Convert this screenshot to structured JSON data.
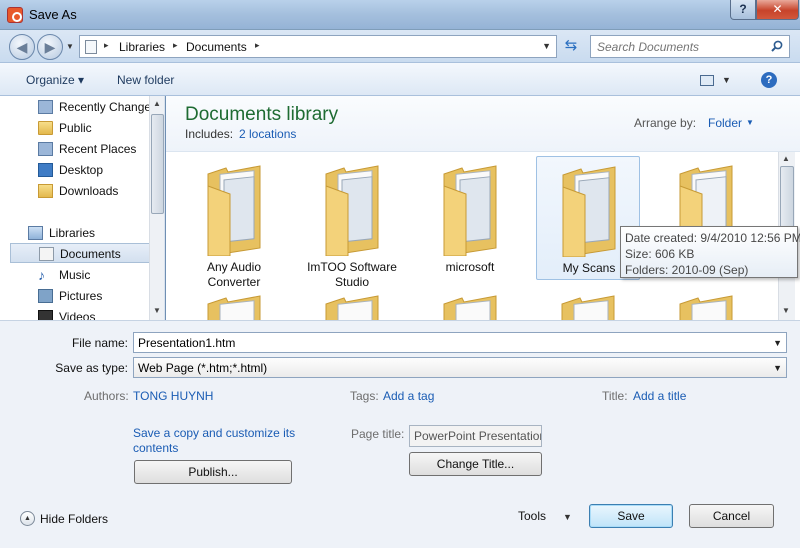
{
  "window": {
    "title": "Save As",
    "help_glyph": "?",
    "close_glyph": "✕"
  },
  "address": {
    "crumbs": [
      "Libraries",
      "Documents"
    ],
    "separator": "▸"
  },
  "search": {
    "placeholder": "Search Documents"
  },
  "toolbar": {
    "organize": "Organize ▾",
    "new_folder": "New folder",
    "help": "?"
  },
  "nav": {
    "items": [
      {
        "label": "Recently Changed",
        "icon": "recent-icon"
      },
      {
        "label": "Public",
        "icon": "folder-icon"
      },
      {
        "label": "Recent Places",
        "icon": "recent-places-icon"
      },
      {
        "label": "Desktop",
        "icon": "desktop-icon"
      },
      {
        "label": "Downloads",
        "icon": "downloads-icon"
      },
      {
        "label": "Libraries",
        "icon": "library-icon"
      },
      {
        "label": "Documents",
        "icon": "documents-icon"
      },
      {
        "label": "Music",
        "icon": "music-icon"
      },
      {
        "label": "Pictures",
        "icon": "pictures-icon"
      },
      {
        "label": "Videos",
        "icon": "videos-icon"
      }
    ],
    "music_glyph": "♪"
  },
  "library": {
    "title": "Documents library",
    "includes_label": "Includes:",
    "includes_link": "2 locations",
    "arrange_label": "Arrange by:",
    "arrange_value": "Folder"
  },
  "folders": [
    {
      "line1": "Any Audio",
      "line2": "Converter"
    },
    {
      "line1": "ImTOO Software",
      "line2": "Studio"
    },
    {
      "line1": "microsoft",
      "line2": ""
    },
    {
      "line1": "My Scans",
      "line2": ""
    },
    {
      "line1": "",
      "line2": ""
    }
  ],
  "tooltip": {
    "date": "Date created: 9/4/2010 12:56 PM",
    "size": "Size: 606 KB",
    "folders": "Folders: 2010-09 (Sep)"
  },
  "form": {
    "file_name_label": "File name:",
    "file_name": "Presentation1.htm",
    "save_type_label": "Save as type:",
    "save_type": "Web Page (*.htm;*.html)",
    "authors_label": "Authors:",
    "authors": "TONG HUYNH",
    "tags_label": "Tags:",
    "tags": "Add a tag",
    "title_label": "Title:",
    "title": "Add a title",
    "save_copy_line1": "Save a copy and customize its",
    "save_copy_line2": "contents",
    "publish": "Publish...",
    "page_title_label": "Page title:",
    "page_title": "PowerPoint Presentation",
    "change_title": "Change Title...",
    "hide_folders": "Hide Folders",
    "tools": "Tools",
    "save": "Save",
    "cancel": "Cancel"
  }
}
